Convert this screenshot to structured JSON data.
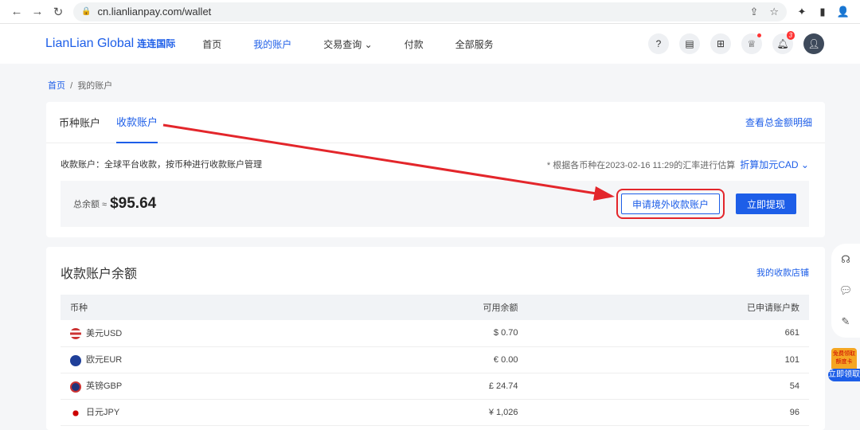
{
  "browser": {
    "url": "cn.lianlianpay.com/wallet"
  },
  "header": {
    "logo": "LianLian Global",
    "logo_cn": "连连国际",
    "menu": [
      "首页",
      "我的账户",
      "交易查询",
      "付款",
      "全部服务"
    ],
    "notif_count": "3"
  },
  "breadcrumb": {
    "home": "首页",
    "sep": "/",
    "current": "我的账户"
  },
  "account": {
    "tabs": [
      "币种账户",
      "收款账户"
    ],
    "total_link": "查看总金额明细",
    "desc": "收款账户：全球平台收款，按币种进行收款账户管理",
    "rate_note": "* 根据各币种在2023-02-16 11:29的汇率进行估算",
    "convert": "折算加元CAD ⌄",
    "balance_label": "总余额 ≈",
    "balance": "$95.64",
    "apply_btn": "申请境外收款账户",
    "withdraw_btn": "立即提现"
  },
  "balances": {
    "title": "收款账户余额",
    "store_link": "我的收款店铺",
    "headers": [
      "币种",
      "可用余额",
      "已申请账户数"
    ],
    "rows": [
      {
        "currency": "美元USD",
        "amount": "$ 0.70",
        "count": "661"
      },
      {
        "currency": "欧元EUR",
        "amount": "€ 0.00",
        "count": "101"
      },
      {
        "currency": "英镑GBP",
        "amount": "£  24.74",
        "count": "54"
      },
      {
        "currency": "日元JPY",
        "amount": "¥  1,026",
        "count": "96"
      }
    ]
  },
  "promo": {
    "top": "免费领取额度卡",
    "button": "立即领取"
  },
  "colors": {
    "accent": "#1d5ee8",
    "annotation": "#e3262b"
  }
}
